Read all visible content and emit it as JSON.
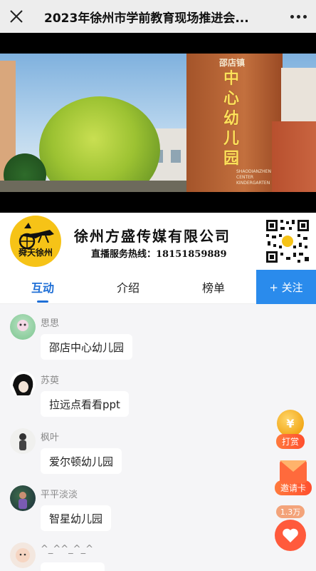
{
  "topbar": {
    "title": "2023年徐州市学前教育现场推进会..."
  },
  "video": {
    "sign_top": "邵店镇",
    "sign_chars": [
      "中",
      "心",
      "幼",
      "儿",
      "园"
    ],
    "sign_en": [
      "SHAODIANZHEN",
      "CENTER",
      "KINDERGARTEN"
    ]
  },
  "banner": {
    "logo_text": "舜天徐州",
    "company": "徐州方盛传媒有限公司",
    "hotline": "直播服务热线：18151859889"
  },
  "tabs": [
    {
      "label": "互动",
      "active": true
    },
    {
      "label": "介绍",
      "active": false
    },
    {
      "label": "榜单",
      "active": false
    }
  ],
  "follow_label": "+ 关注",
  "comments": [
    {
      "user": "思思",
      "text": "邵店中心幼儿园"
    },
    {
      "user": "苏萸",
      "text": "拉远点看看ppt"
    },
    {
      "user": "枫叶",
      "text": "爱尔顿幼儿园"
    },
    {
      "user": "平平淡淡",
      "text": "智星幼儿园"
    },
    {
      "user": "^_^^_^_^",
      "text": ""
    }
  ],
  "widgets": {
    "reward_coin": "¥",
    "reward_label": "打赏",
    "invite_label": "邀请卡",
    "likes_count": "1.3万"
  },
  "colors": {
    "accent": "#1f6fd6",
    "follow_bg": "#2a8bec",
    "reward": "#ff4f2e"
  }
}
